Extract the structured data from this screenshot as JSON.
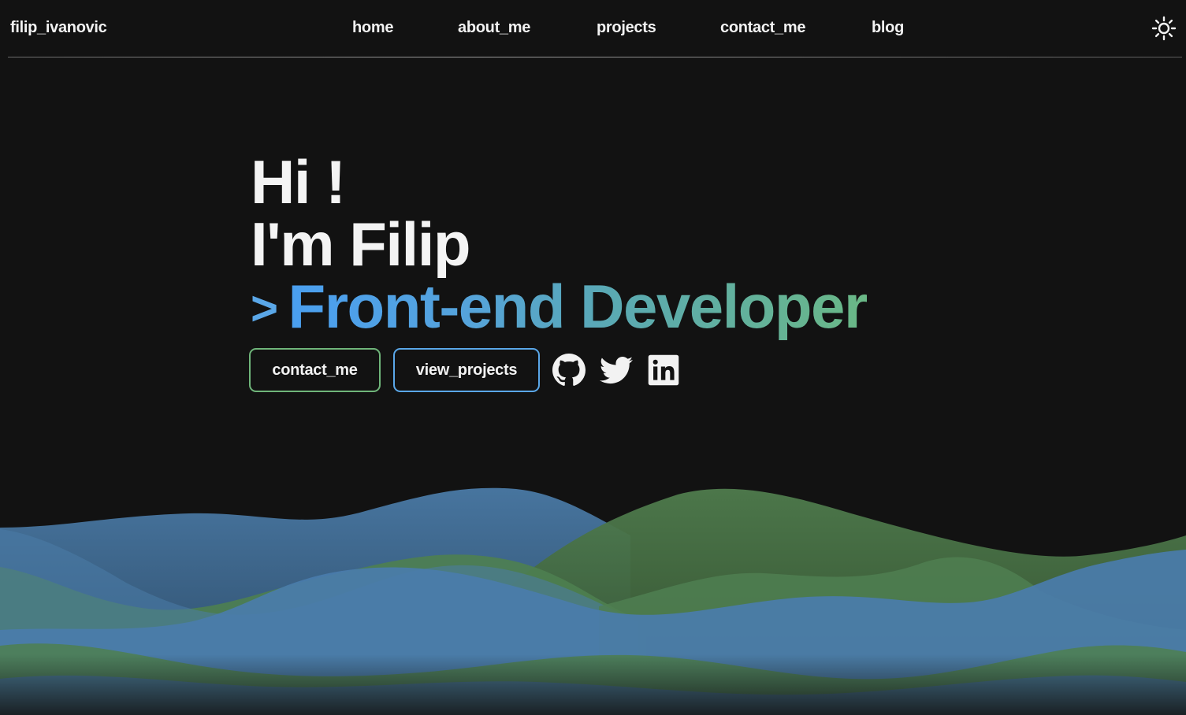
{
  "header": {
    "brand": "filip_ivanovic",
    "nav": [
      {
        "label": "home"
      },
      {
        "label": "about_me"
      },
      {
        "label": "projects"
      },
      {
        "label": "contact_me"
      },
      {
        "label": "blog"
      }
    ],
    "theme_toggle_icon": "sun-icon"
  },
  "hero": {
    "greeting": "Hi !",
    "intro": "I'm Filip",
    "prompt": ">",
    "role": "Front-end Developer",
    "buttons": {
      "contact_label": "contact_me",
      "projects_label": "view_projects"
    },
    "social": [
      {
        "icon": "github-icon"
      },
      {
        "icon": "twitter-icon"
      },
      {
        "icon": "linkedin-icon"
      }
    ]
  },
  "colors": {
    "background": "#121212",
    "accent_blue": "#5aa7e8",
    "accent_green": "#6fb57a",
    "wave_blue": "#4a7fae",
    "wave_green": "#4f7f4f"
  }
}
